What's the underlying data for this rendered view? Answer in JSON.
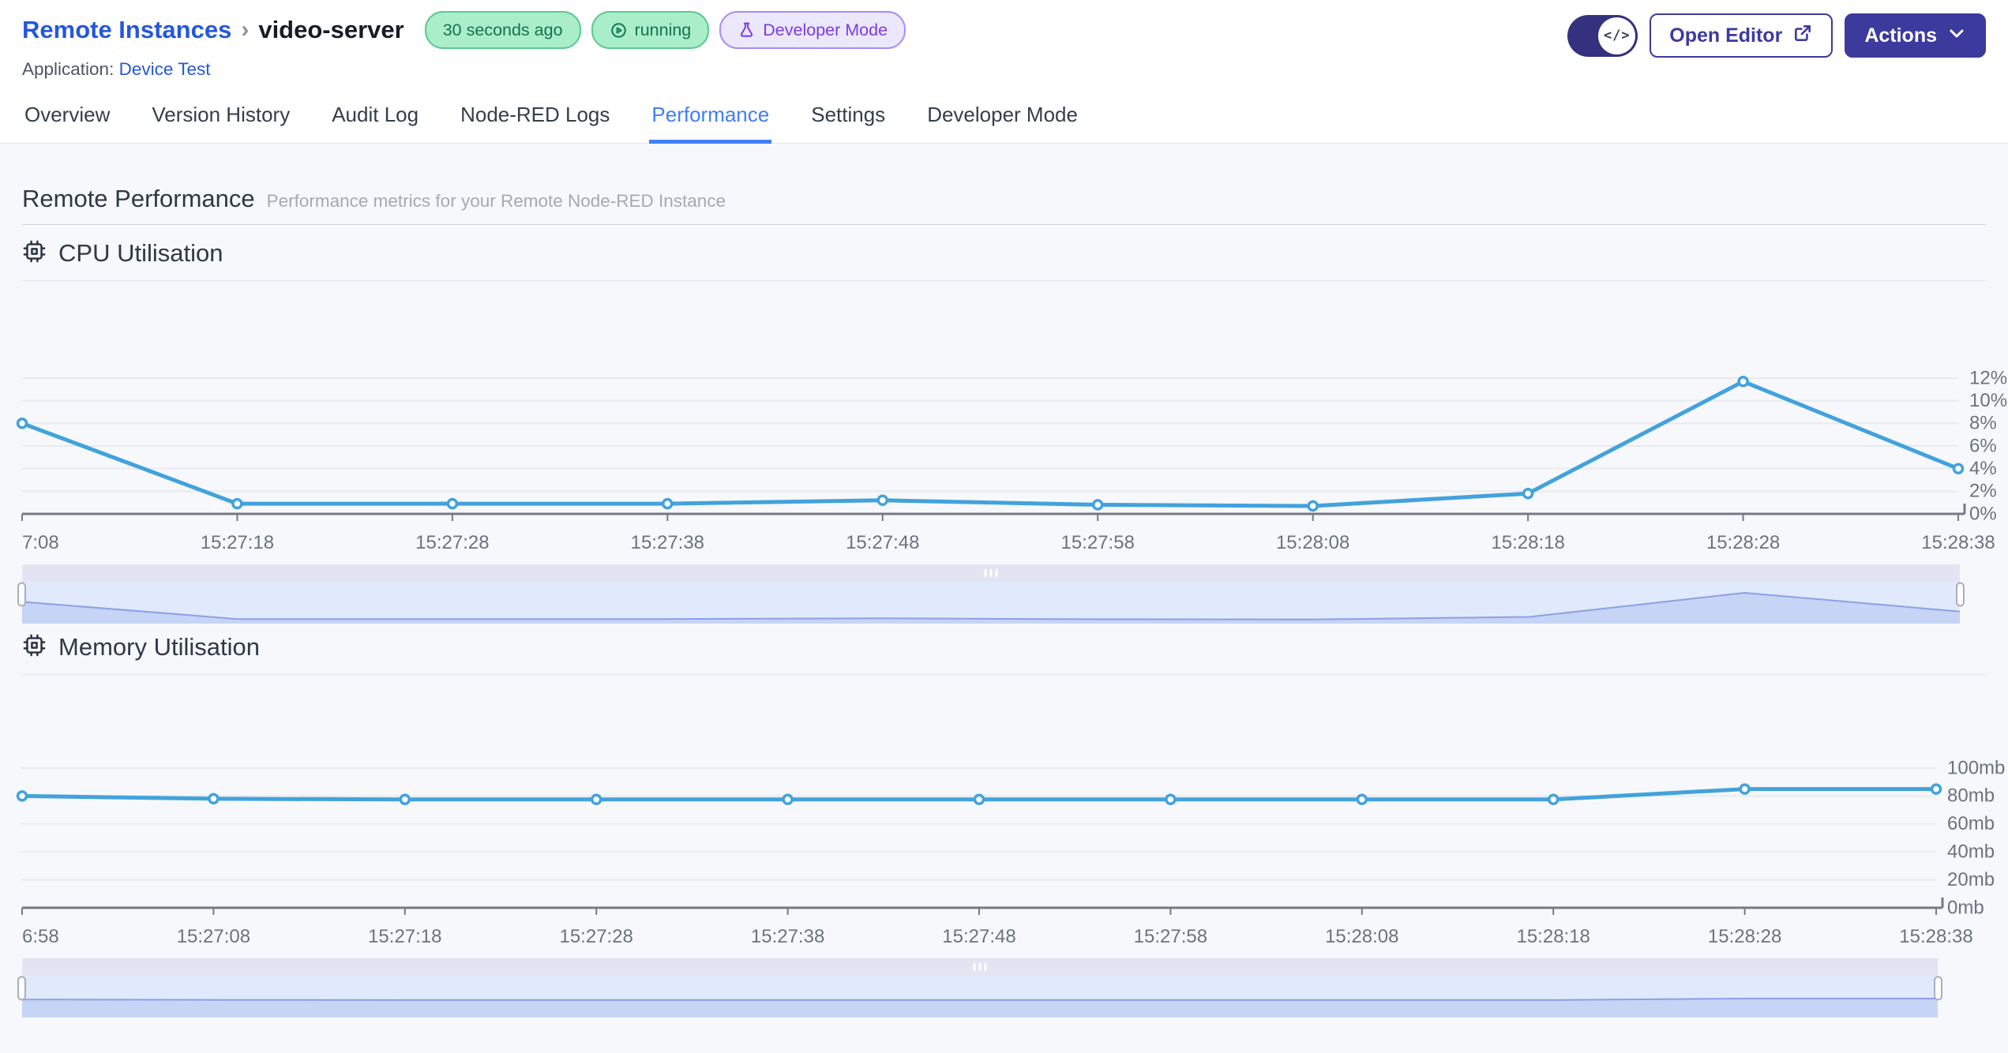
{
  "header": {
    "breadcrumb": {
      "parent": "Remote Instances",
      "separator": "›",
      "current": "video-server"
    },
    "badges": [
      {
        "label": "30 seconds ago",
        "type": "green",
        "icon": ""
      },
      {
        "label": "running",
        "type": "green",
        "icon": "play-circle"
      },
      {
        "label": "Developer Mode",
        "type": "purple",
        "icon": "flask"
      }
    ],
    "application": {
      "label": "Application:",
      "name": "Device Test"
    },
    "controls": {
      "toggle_glyph": "</>",
      "open_editor": "Open Editor",
      "actions": "Actions"
    }
  },
  "tabs": {
    "items": [
      "Overview",
      "Version History",
      "Audit Log",
      "Node-RED Logs",
      "Performance",
      "Settings",
      "Developer Mode"
    ],
    "active": "Performance"
  },
  "page": {
    "title": "Remote Performance",
    "subtitle": "Performance metrics for your Remote Node-RED Instance"
  },
  "colors": {
    "accent_indigo": "#3d3a9e",
    "link_blue": "#2457db",
    "active_tab_blue": "#3f7ef8",
    "line_blue": "#42a2dc",
    "badge_green_bg": "#a9eec9",
    "badge_purple_text": "#7c3aed"
  },
  "chart_data": [
    {
      "type": "line",
      "title": "CPU Utilisation",
      "x": [
        "7:08",
        "15:27:18",
        "15:27:28",
        "15:27:38",
        "15:27:48",
        "15:27:58",
        "15:28:08",
        "15:28:18",
        "15:28:28",
        "15:28:38"
      ],
      "values": [
        8,
        0.9,
        0.9,
        0.9,
        1.2,
        0.8,
        0.7,
        1.8,
        11.7,
        4
      ],
      "yticks": [
        "0%",
        "2%",
        "4%",
        "6%",
        "8%",
        "10%",
        "12%"
      ],
      "ylim": [
        0,
        12
      ],
      "unit": "%",
      "xlabel": "",
      "ylabel": "",
      "grid": true,
      "legend": "none",
      "line_color": "#42a2dc"
    },
    {
      "type": "line",
      "title": "Memory Utilisation",
      "x": [
        "6:58",
        "15:27:08",
        "15:27:18",
        "15:27:28",
        "15:27:38",
        "15:27:48",
        "15:27:58",
        "15:28:08",
        "15:28:18",
        "15:28:28",
        "15:28:38"
      ],
      "values": [
        80,
        78,
        77.5,
        77.5,
        77.5,
        77.5,
        77.5,
        77.5,
        77.5,
        85,
        85
      ],
      "yticks": [
        "0mb",
        "20mb",
        "40mb",
        "60mb",
        "80mb",
        "100mb"
      ],
      "ylim": [
        0,
        100
      ],
      "unit": "mb",
      "xlabel": "",
      "ylabel": "",
      "grid": true,
      "legend": "none",
      "line_color": "#42a2dc"
    }
  ]
}
